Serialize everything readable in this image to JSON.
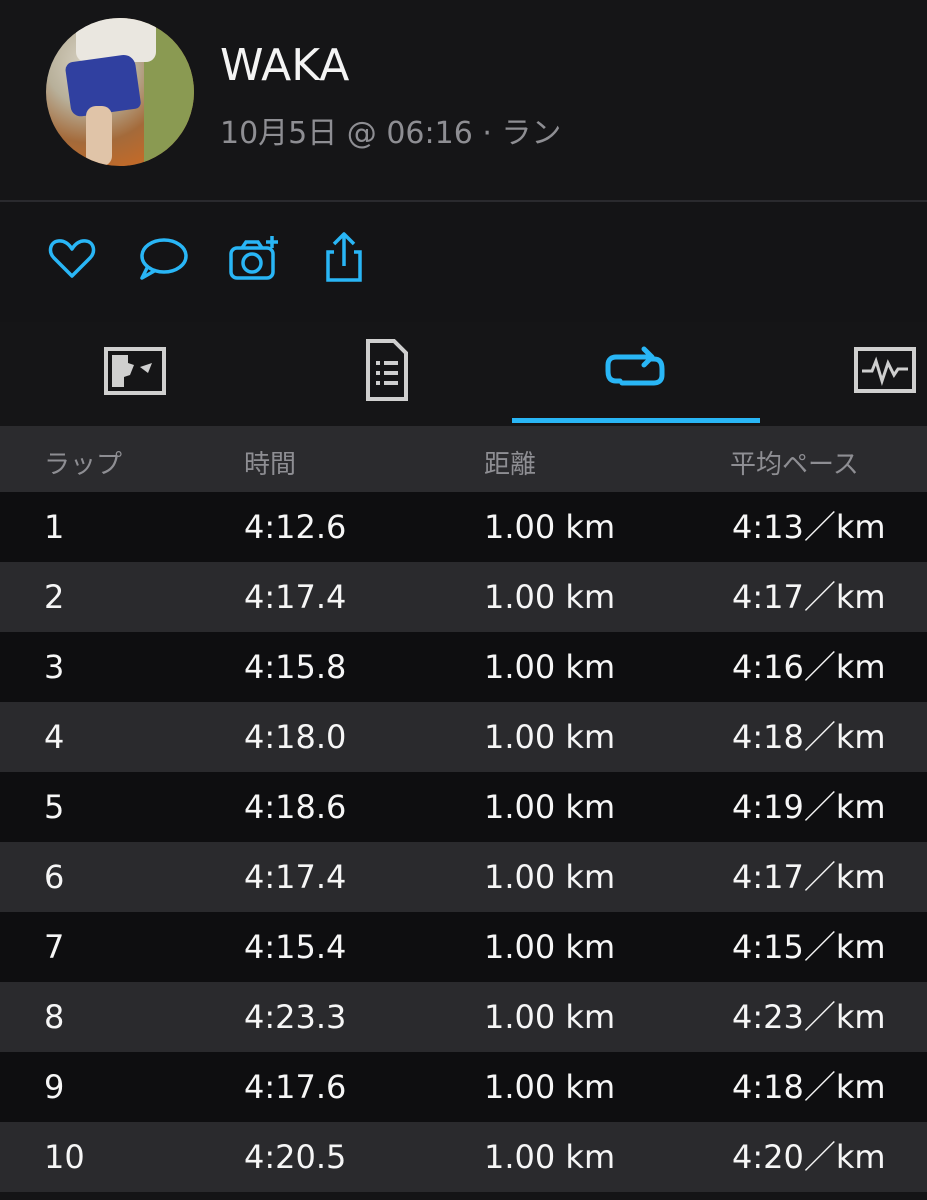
{
  "profile": {
    "name": "WAKA",
    "subtitle": "10月5日 @ 06:16 · ラン"
  },
  "actions": [
    {
      "icon": "heart-icon"
    },
    {
      "icon": "comment-icon"
    },
    {
      "icon": "add-photo-icon"
    },
    {
      "icon": "share-icon"
    }
  ],
  "tabs": [
    {
      "icon": "map-icon"
    },
    {
      "icon": "document-icon"
    },
    {
      "icon": "laps-icon",
      "active": true
    },
    {
      "icon": "chart-icon"
    }
  ],
  "colors": {
    "accent": "#29b6f6",
    "background": "#141416",
    "row_alt": "#2a2a2d"
  },
  "table": {
    "headers": [
      "ラップ",
      "時間",
      "距離",
      "平均ペース"
    ],
    "rows": [
      [
        "1",
        "4:12.6",
        "1.00 km",
        "4:13／km"
      ],
      [
        "2",
        "4:17.4",
        "1.00 km",
        "4:17／km"
      ],
      [
        "3",
        "4:15.8",
        "1.00 km",
        "4:16／km"
      ],
      [
        "4",
        "4:18.0",
        "1.00 km",
        "4:18／km"
      ],
      [
        "5",
        "4:18.6",
        "1.00 km",
        "4:19／km"
      ],
      [
        "6",
        "4:17.4",
        "1.00 km",
        "4:17／km"
      ],
      [
        "7",
        "4:15.4",
        "1.00 km",
        "4:15／km"
      ],
      [
        "8",
        "4:23.3",
        "1.00 km",
        "4:23／km"
      ],
      [
        "9",
        "4:17.6",
        "1.00 km",
        "4:18／km"
      ],
      [
        "10",
        "4:20.5",
        "1.00 km",
        "4:20／km"
      ]
    ]
  }
}
